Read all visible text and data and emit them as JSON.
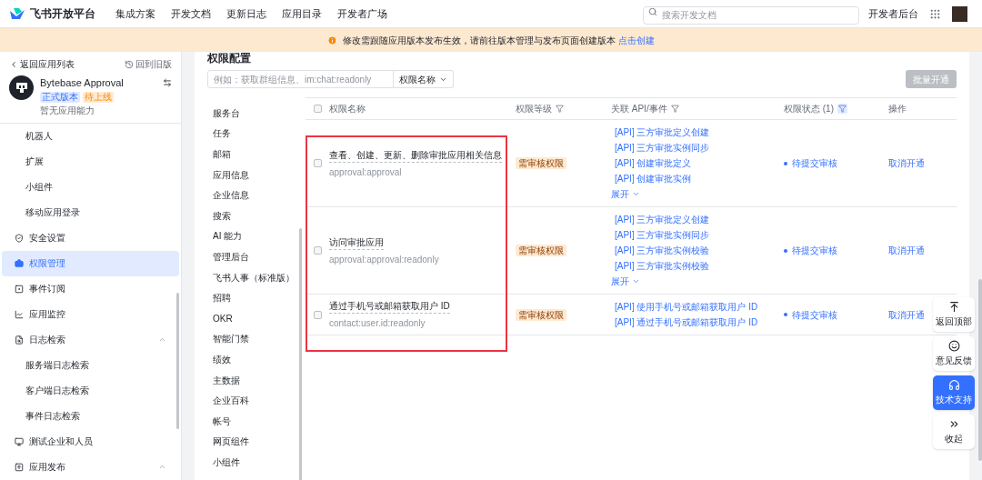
{
  "nav": {
    "logo": "飞书开放平台",
    "links": [
      "集成方案",
      "开发文档",
      "更新日志",
      "应用目录",
      "开发者广场"
    ],
    "search": {
      "placeholder": "搜索开发文档"
    },
    "console": "开发者后台"
  },
  "banner": {
    "text": "修改需跟随应用版本发布生效，请前往版本管理与发布页面创建版本",
    "link": "点击创建"
  },
  "sidebar": {
    "back": "返回应用列表",
    "old_version": "回到旧版",
    "app": {
      "name": "Bytebase Approval",
      "badges": [
        {
          "label": "正式版本",
          "kind": "info"
        },
        {
          "label": "待上线",
          "kind": "warn"
        }
      ],
      "desc": "暂无应用能力"
    },
    "items": [
      {
        "label": "机器人",
        "kind": "sub",
        "selected": false
      },
      {
        "label": "扩展",
        "kind": "sub",
        "selected": false
      },
      {
        "label": "小组件",
        "kind": "sub",
        "selected": false
      },
      {
        "label": "移动应用登录",
        "kind": "sub",
        "selected": false
      },
      {
        "label": "安全设置",
        "kind": "main",
        "selected": false
      },
      {
        "label": "权限管理",
        "kind": "main",
        "selected": true
      },
      {
        "label": "事件订阅",
        "kind": "main",
        "selected": false
      },
      {
        "label": "应用监控",
        "kind": "main",
        "selected": false
      },
      {
        "label": "日志检索",
        "kind": "main",
        "selected": false,
        "expanded": true,
        "children": [
          {
            "label": "服务端日志检索",
            "selected": false
          },
          {
            "label": "客户端日志检索",
            "selected": false
          },
          {
            "label": "事件日志检索",
            "selected": false
          }
        ]
      },
      {
        "label": "测试企业和人员",
        "kind": "main",
        "selected": false
      },
      {
        "label": "应用发布",
        "kind": "main",
        "selected": false,
        "expanded": true
      }
    ]
  },
  "main": {
    "title": "权限配置",
    "search": {
      "placeholder": "例如：获取群组信息、im:chat:readonly",
      "scope": "权限名称"
    },
    "bulk_button": {
      "label": "批量开通",
      "disabled": true
    },
    "categories": [
      "服务台",
      "任务",
      "邮箱",
      "应用信息",
      "企业信息",
      "搜索",
      "AI 能力",
      "管理后台",
      "飞书人事（标准版）",
      "招聘",
      "OKR",
      "智能门禁",
      "绩效",
      "主数据",
      "企业百科",
      "帐号",
      "网页组件",
      "小组件"
    ],
    "table": {
      "select_all": {
        "checked": false
      },
      "columns": [
        {
          "label": "权限名称",
          "filter": false
        },
        {
          "label": "权限等级",
          "filter": true,
          "filter_active": false
        },
        {
          "label": "关联 API/事件",
          "filter": true,
          "filter_active": false
        },
        {
          "label": "权限状态 (1)",
          "filter": true,
          "filter_active": true
        },
        {
          "label": "操作",
          "filter": false
        }
      ],
      "rows": [
        {
          "checked": false,
          "name": "查看、创建、更新、删除审批应用相关信息",
          "scope": "approval:approval",
          "level": "需审核权限",
          "apis": [
            "[API] 三方审批定义创建",
            "[API] 三方审批实例同步",
            "[API] 创建审批定义",
            "[API] 创建审批实例"
          ],
          "more": "展开",
          "status": "待提交审核",
          "color": "#3370ff",
          "action": "取消开通"
        },
        {
          "checked": false,
          "name": "访问审批应用",
          "scope": "approval:approval:readonly",
          "level": "需审核权限",
          "apis": [
            "[API] 三方审批定义创建",
            "[API] 三方审批实例同步",
            "[API] 三方审批实例校验",
            "[API] 三方审批实例校验"
          ],
          "more": "展开",
          "status": "待提交审核",
          "color": "#3370ff",
          "action": "取消开通"
        },
        {
          "checked": false,
          "name": "通过手机号或邮箱获取用户 ID",
          "scope": "contact:user.id:readonly",
          "level": "需审核权限",
          "apis": [
            "[API] 使用手机号或邮箱获取用户 ID",
            "[API] 通过手机号或邮箱获取用户 ID"
          ],
          "status": "待提交审核",
          "color": "#3370ff",
          "action": "取消开通"
        }
      ]
    }
  },
  "float_buttons": [
    {
      "label": "返回顶部",
      "selected": false
    },
    {
      "label": "意见反馈",
      "selected": false
    },
    {
      "label": "技术支持",
      "selected": true
    },
    {
      "label": "收起",
      "selected": false
    }
  ]
}
